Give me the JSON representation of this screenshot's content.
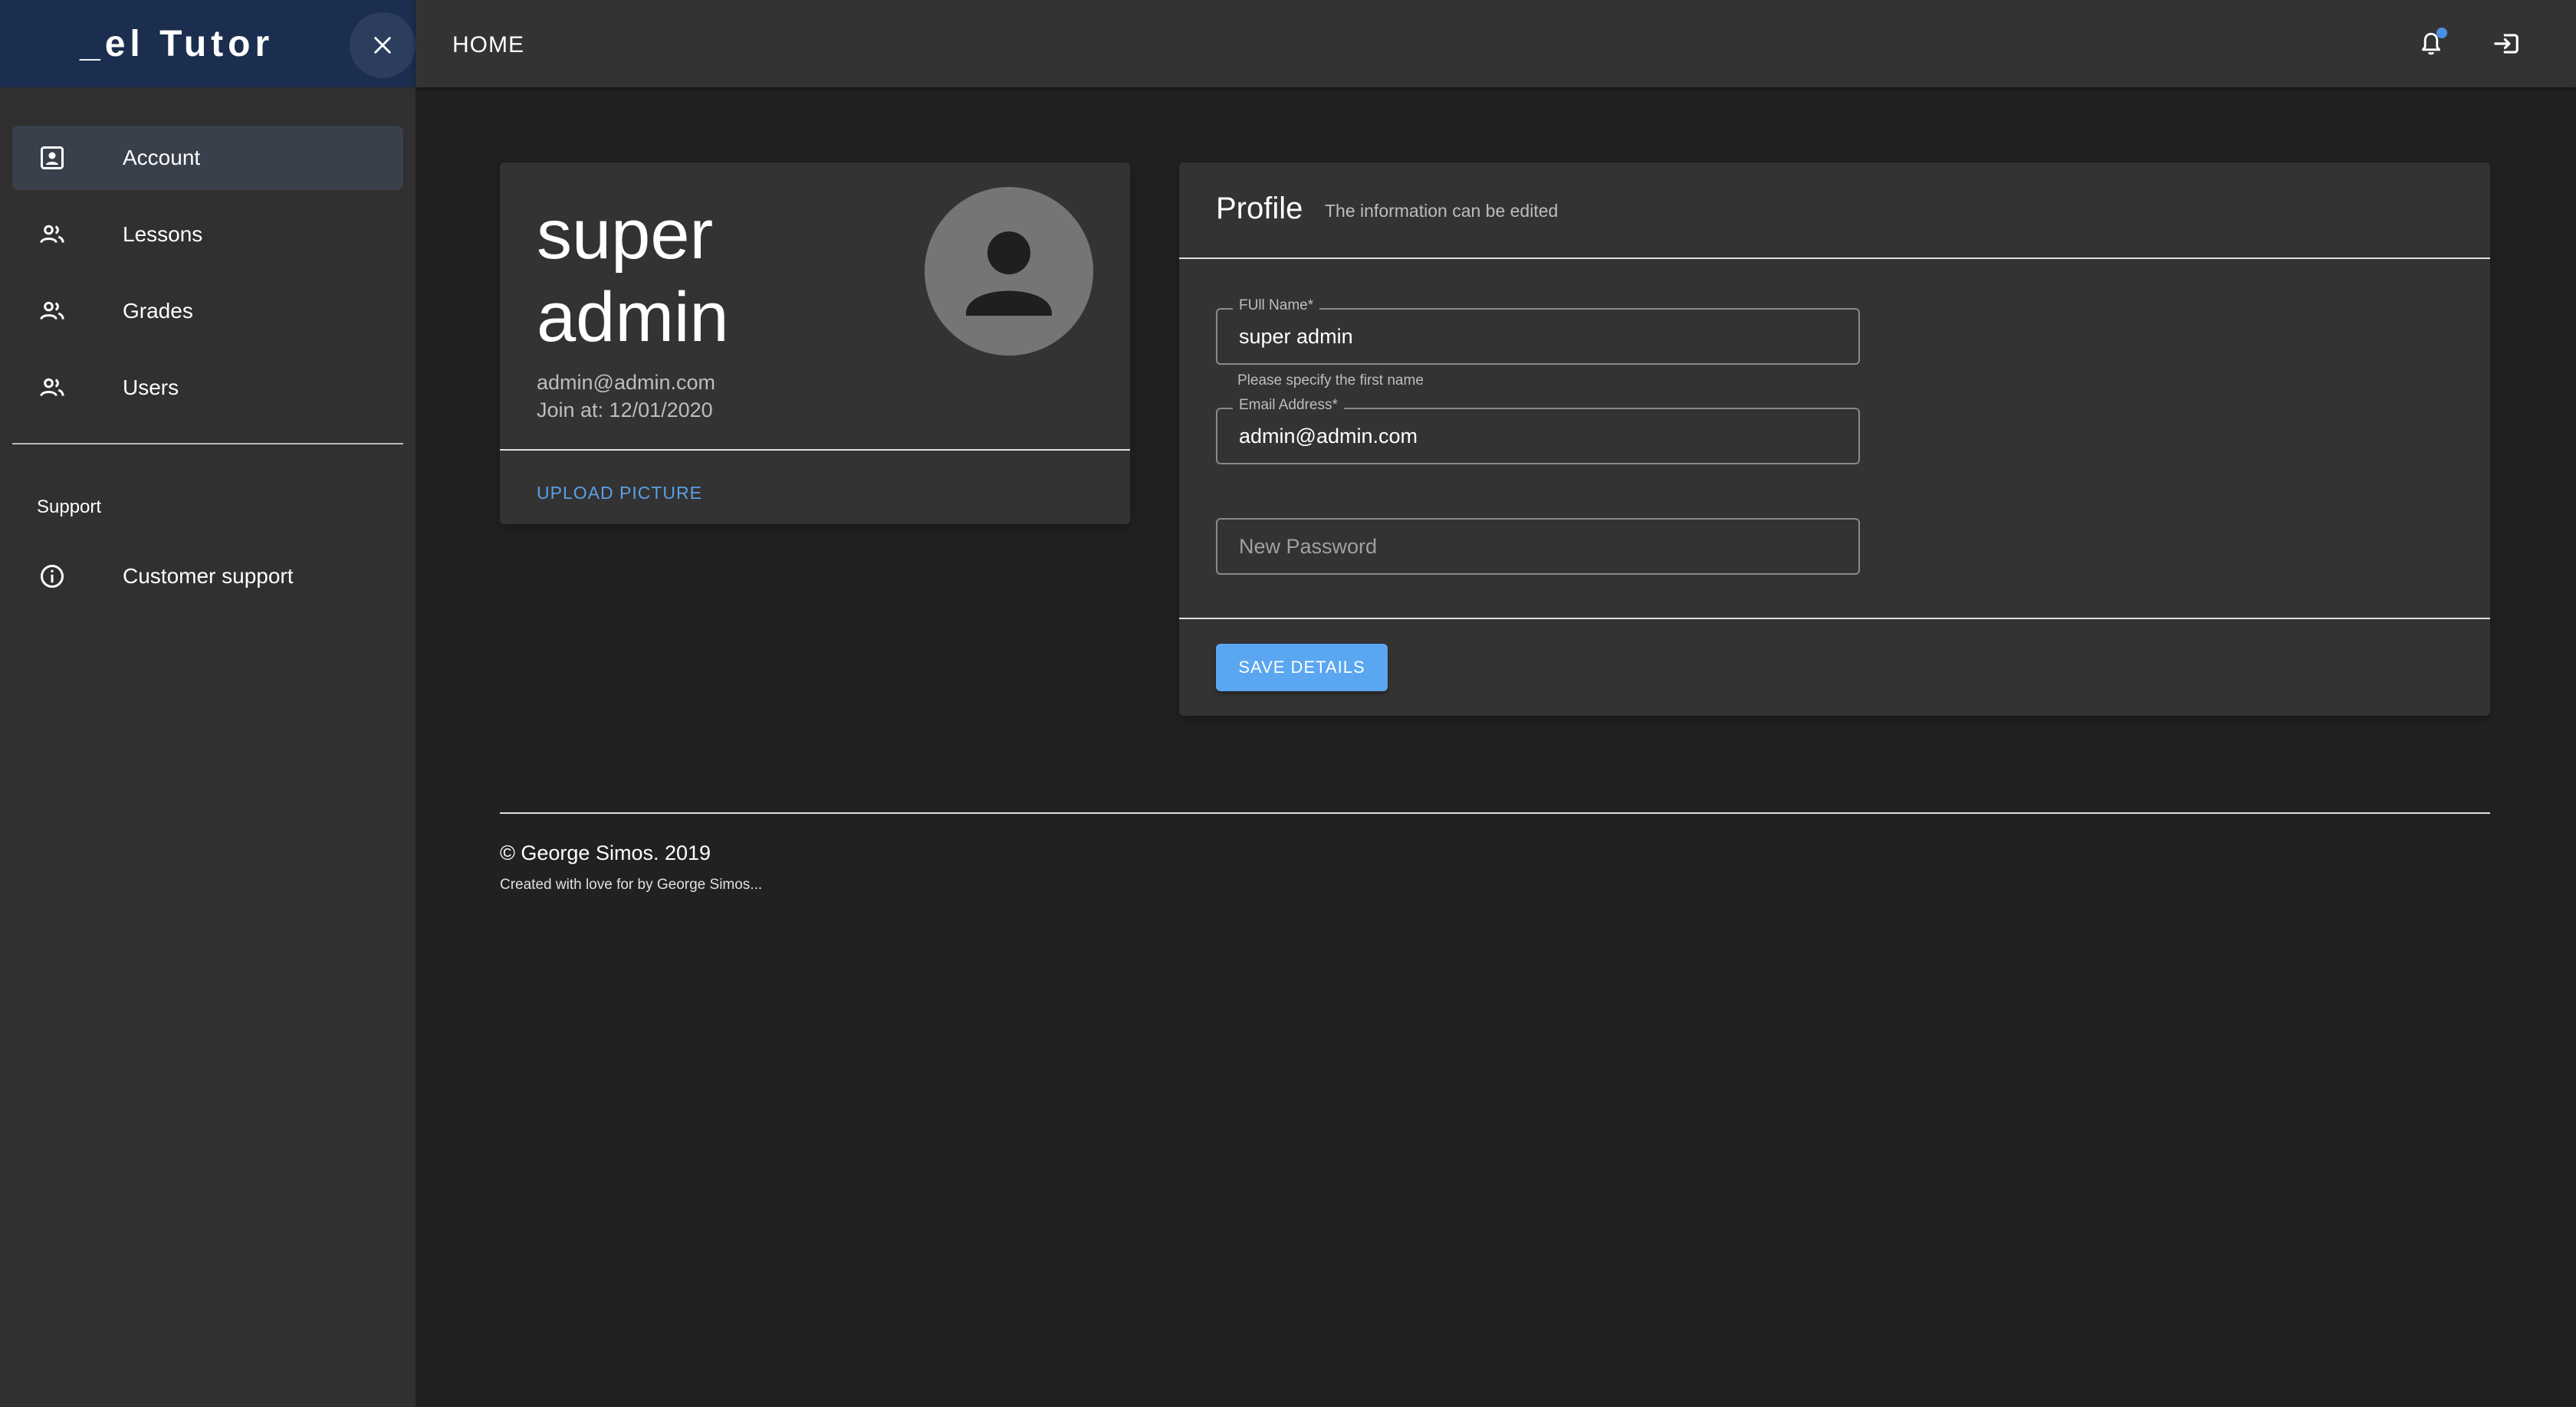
{
  "sidebar": {
    "brand": "_el Tutor",
    "items": [
      {
        "label": "Account",
        "icon": "account-box-icon",
        "active": true
      },
      {
        "label": "Lessons",
        "icon": "people-icon",
        "active": false
      },
      {
        "label": "Grades",
        "icon": "people-icon",
        "active": false
      },
      {
        "label": "Users",
        "icon": "people-icon",
        "active": false
      }
    ],
    "section": "Support",
    "support_items": [
      {
        "label": "Customer support",
        "icon": "info-icon"
      }
    ]
  },
  "topbar": {
    "title": "HOME"
  },
  "account": {
    "name": "super admin",
    "email": "admin@admin.com",
    "join": "Join at: 12/01/2020",
    "upload_label": "UPLOAD PICTURE"
  },
  "profile": {
    "title": "Profile",
    "subtitle": "The information can be edited",
    "fields": {
      "full_name_label": "FUll Name*",
      "full_name_value": "super admin",
      "full_name_helper": "Please specify the first name",
      "email_label": "Email Address*",
      "email_value": "admin@admin.com",
      "password_placeholder": "New Password"
    },
    "save_label": "SAVE DETAILS"
  },
  "footer": {
    "copyright": "© George Simos. 2019",
    "credit": "Created with love for by George Simos..."
  },
  "colors": {
    "accent": "#5aa6f0",
    "sidebar_header": "#1c2e4f",
    "background": "#212121",
    "card": "#333333"
  }
}
